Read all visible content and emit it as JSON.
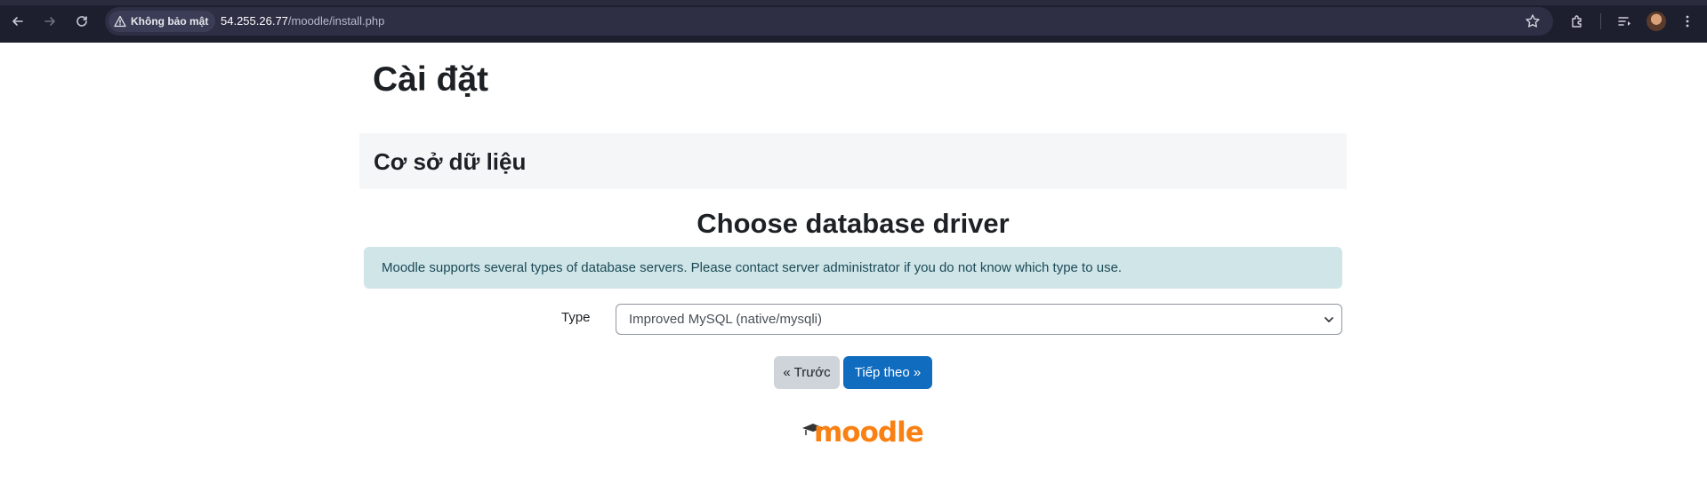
{
  "browser": {
    "security_label": "Không bảo mật",
    "url_host": "54.255.26.77",
    "url_path": "/moodle/install.php"
  },
  "page": {
    "title": "Cài đặt",
    "section_title": "Cơ sở dữ liệu",
    "subheading": "Choose database driver",
    "info_text": "Moodle supports several types of database servers. Please contact server administrator if you do not know which type to use.",
    "type_label": "Type",
    "type_selected": "Improved MySQL (native/mysqli)",
    "prev_button": "« Trước",
    "next_button": "Tiếp theo »",
    "logo_text": "moodle"
  },
  "colors": {
    "brand_orange": "#f98012",
    "primary_button": "#0f6cbf",
    "info_alert_bg": "#cfe5e8"
  }
}
